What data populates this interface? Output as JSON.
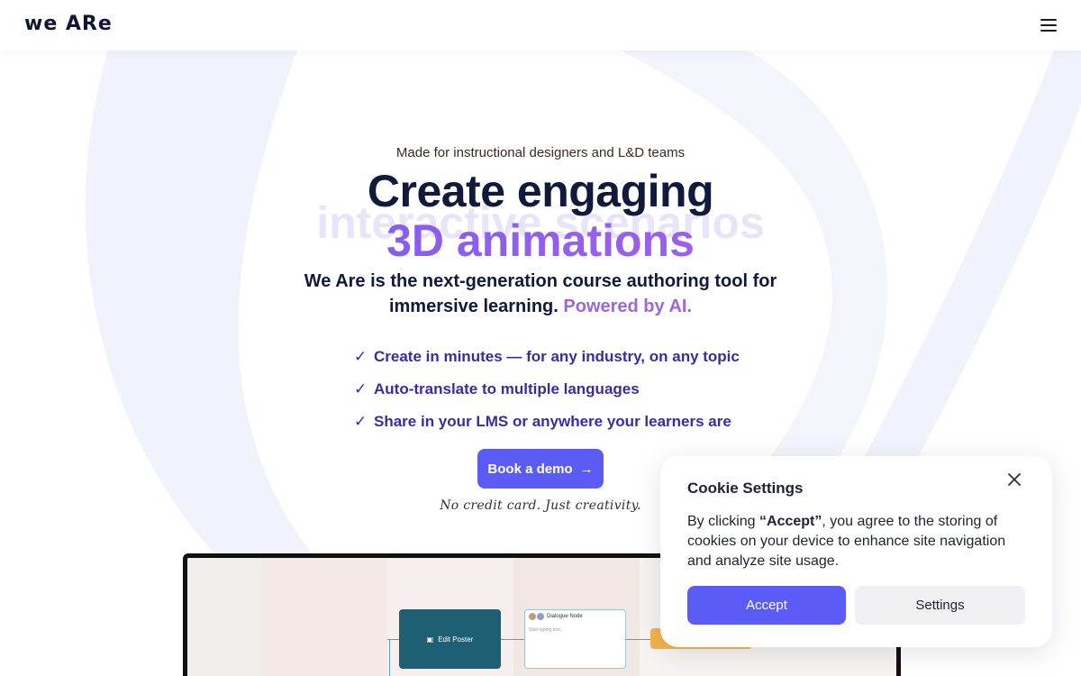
{
  "header": {
    "logo": "we ARe",
    "menu_icon": "hamburger-menu-icon"
  },
  "hero": {
    "eyebrow": "Made for instructional designers and L&D teams",
    "headline_line1": "Create engaging",
    "headline_ghost": "interactive scenarios",
    "headline_line2": "3D animations",
    "subhead_main": "We Are is the next-generation course authoring tool for immersive learning.",
    "subhead_ai": "Powered by AI.",
    "features": [
      "Create in minutes — for any industry, on any topic",
      "Auto-translate to multiple languages",
      "Share in your LMS or anywhere your learners are"
    ],
    "check_icon": "check-icon",
    "cta_label": "Book a demo",
    "cta_icon": "arrow-right-icon",
    "note": "No credit card. Just creativity."
  },
  "preview": {
    "edit_poster": "Edit Poster",
    "dialogue_title": "Dialogue Node",
    "dialogue_text": "Start typing text..."
  },
  "cookie": {
    "title": "Cookie Settings",
    "text_prefix": "By clicking ",
    "text_bold": "“Accept”",
    "text_suffix": ", you agree to the storing of cookies on your device to enhance site navigation and analyze site usage.",
    "accept_label": "Accept",
    "settings_label": "Settings",
    "close_icon": "close-icon"
  },
  "colors": {
    "accent": "#5b5cf6",
    "headline_dark": "#0f1a3d",
    "feature_purple": "#3e2a9e",
    "ai_purple": "#9b66e0"
  }
}
